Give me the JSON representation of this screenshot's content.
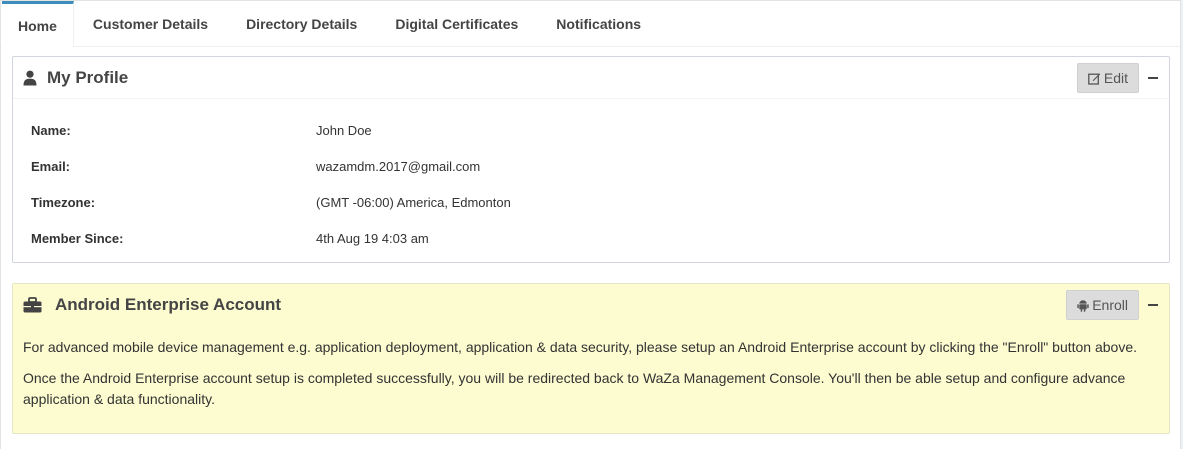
{
  "tabs": [
    {
      "label": "Home",
      "active": true
    },
    {
      "label": "Customer Details",
      "active": false
    },
    {
      "label": "Directory Details",
      "active": false
    },
    {
      "label": "Digital Certificates",
      "active": false
    },
    {
      "label": "Notifications",
      "active": false
    }
  ],
  "profile": {
    "title": "My Profile",
    "edit_label": "Edit",
    "fields": [
      {
        "label": "Name:",
        "value": "John Doe"
      },
      {
        "label": "Email:",
        "value": "wazamdm.2017@gmail.com"
      },
      {
        "label": "Timezone:",
        "value": "(GMT -06:00) America, Edmonton"
      },
      {
        "label": "Member Since:",
        "value": "4th Aug 19 4:03 am"
      }
    ]
  },
  "android": {
    "title": "Android Enterprise Account",
    "enroll_label": "Enroll",
    "paragraphs": [
      "For advanced mobile device management e.g. application deployment, application & data security, please setup an Android Enterprise account by clicking the \"Enroll\" button above.",
      "Once the Android Enterprise account setup is completed successfully, you will be redirected back to WaZa Management Console. You'll then be able setup and configure advance application & data functionality."
    ]
  },
  "icons": {
    "profile": "user-icon",
    "android": "briefcase-icon",
    "edit": "edit-icon",
    "enroll": "android-icon",
    "collapse": "minus-icon"
  },
  "colors": {
    "tab_accent": "#3c8dbc",
    "android_box_bg": "#fcfcd0",
    "button_bg": "#dcdcdc"
  }
}
